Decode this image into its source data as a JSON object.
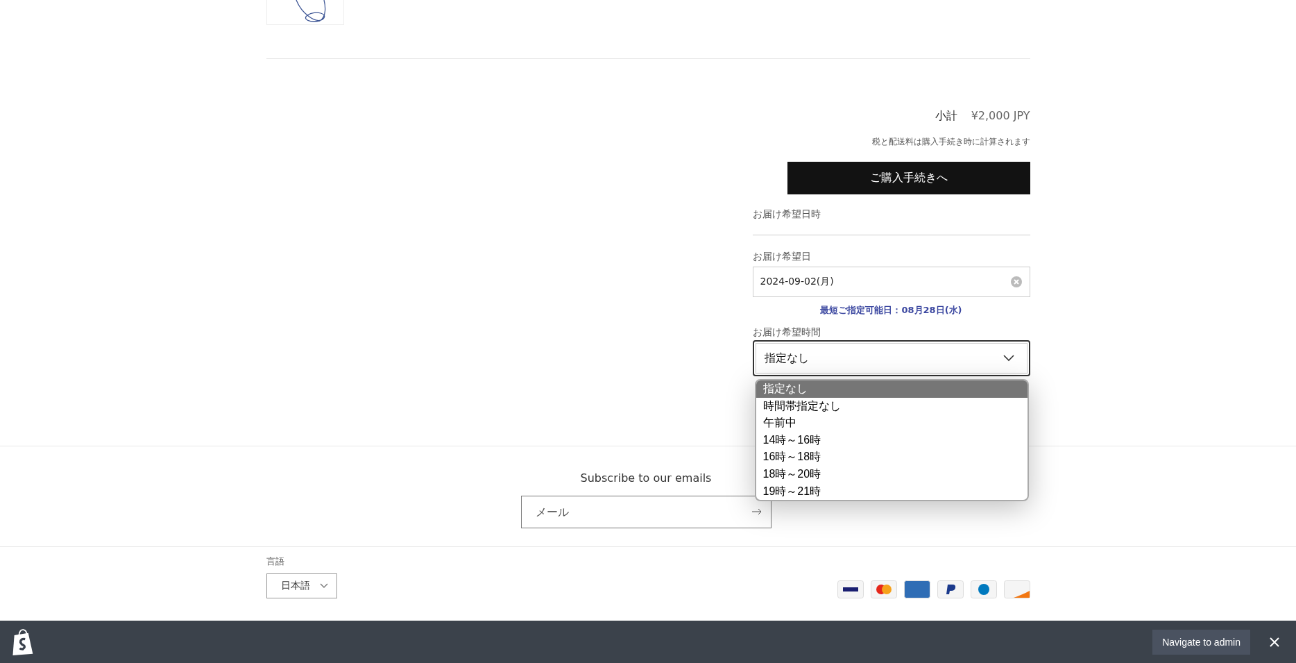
{
  "cart_summary": {
    "subtotal_label": "小計",
    "subtotal": "¥2,000 JPY",
    "tax_note": "税と配送料は購入手続き時に計算されます",
    "checkout_button": "ご購入手続きへ"
  },
  "delivery": {
    "title": "お届け希望日時",
    "date_label": "お届け希望日",
    "date_value": "2024-09-02(月)",
    "earliest_note": "最短ご指定可能日：08月28日(水)",
    "time_label": "お届け希望時間",
    "time_value": "指定なし",
    "expanded": true,
    "time_options": [
      {
        "label": "指定なし",
        "selected": true
      },
      {
        "label": "時間帯指定なし",
        "selected": false
      },
      {
        "label": "午前中",
        "selected": false
      },
      {
        "label": "14時～16時",
        "selected": false
      },
      {
        "label": "16時～18時",
        "selected": false
      },
      {
        "label": "18時～20時",
        "selected": false
      },
      {
        "label": "19時～21時",
        "selected": false
      }
    ]
  },
  "newsletter": {
    "heading": "Subscribe to our emails",
    "email_placeholder": "メール"
  },
  "footer": {
    "language_label": "言語",
    "language_value": "日本語"
  },
  "admin_bar": {
    "button": "Navigate to admin"
  }
}
